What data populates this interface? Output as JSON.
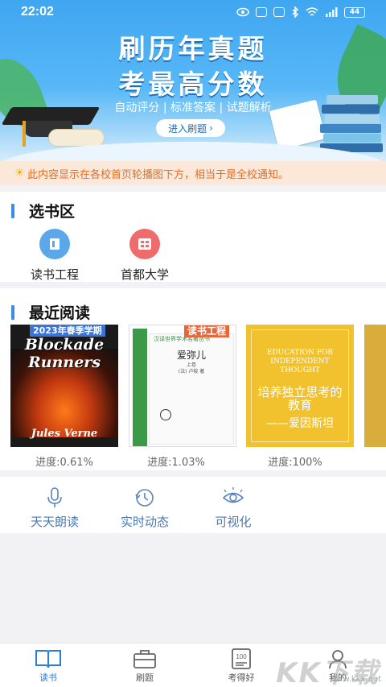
{
  "status_bar": {
    "time": "22:02",
    "battery": "44"
  },
  "banner": {
    "title_line1": "刷历年真题",
    "title_line2": "考最高分数",
    "subtitle": "自动评分 | 标准答案 | 试题解析",
    "button_label": "进入刷题",
    "button_arrow": "›"
  },
  "notice": {
    "icon": "sun-icon",
    "text": "此内容显示在各校首页轮播图下方，相当于是全校通知。"
  },
  "book_select": {
    "title": "选书区",
    "items": [
      {
        "label": "读书工程",
        "icon": "book-icon",
        "color": "#5aa8ea"
      },
      {
        "label": "首都大学",
        "icon": "grid-icon",
        "color": "#ef6c6c"
      }
    ]
  },
  "recent": {
    "title": "最近阅读",
    "books": [
      {
        "tag": "2023年春季学期",
        "cover_title": "Blockade Runners",
        "author": "Jules Verne",
        "progress": "进度:0.61%"
      },
      {
        "tag": "读书工程",
        "cover_title": "爱弥儿",
        "cover_series": "汉译世界学术名著丛书",
        "author": "(法) 卢梭 著",
        "cover_vol": "上卷",
        "progress": "进度:1.03%"
      },
      {
        "cover_title_en": "EDUCATION FOR INDEPENDENT THOUGHT",
        "cover_title": "培养独立思考的教育",
        "author": "——爱因斯坦",
        "progress": "进度:100%"
      }
    ]
  },
  "tools": [
    {
      "label": "天天朗读",
      "icon": "microphone-icon"
    },
    {
      "label": "实时动态",
      "icon": "history-icon"
    },
    {
      "label": "可视化",
      "icon": "eye-icon"
    }
  ],
  "bottom_nav": [
    {
      "label": "读书",
      "icon": "open-book-icon",
      "active": true
    },
    {
      "label": "刷题",
      "icon": "toolbox-icon",
      "active": false
    },
    {
      "label": "考得好",
      "icon": "score-100-icon",
      "active": false
    },
    {
      "label": "我的",
      "icon": "user-icon",
      "active": false
    }
  ],
  "watermark": {
    "big": "KK下载",
    "small": "www.kkx.net"
  },
  "colors": {
    "accent": "#2b7be0",
    "notice_text": "#e0702a",
    "notice_bg": "#fbe8d9",
    "section_bar": "#3b8ee8"
  }
}
